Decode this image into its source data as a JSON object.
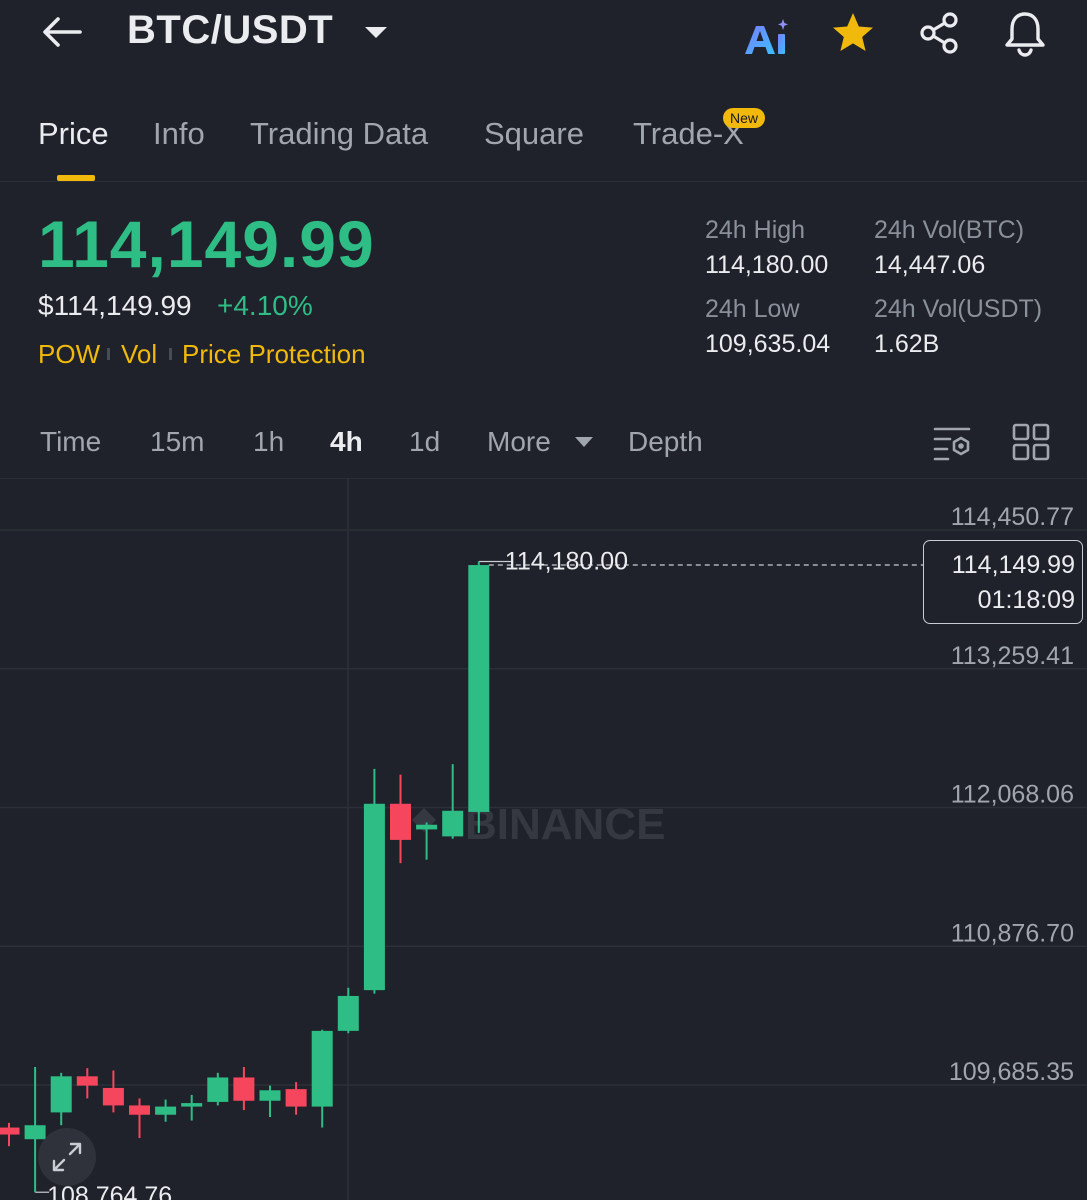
{
  "header": {
    "pair": "BTC/USDT",
    "icons": {
      "back": "arrow-left-icon",
      "caret": "caret-down-icon",
      "ai": "ai-icon",
      "favorite": "star-icon",
      "share": "share-icon",
      "alerts": "bell-icon"
    },
    "colors": {
      "favorite": "#f0b90b"
    }
  },
  "tabs": [
    {
      "label": "Price",
      "active": true
    },
    {
      "label": "Info"
    },
    {
      "label": "Trading Data"
    },
    {
      "label": "Square"
    },
    {
      "label": "Trade-X",
      "badge": "New"
    }
  ],
  "price": {
    "last": "114,149.99",
    "usd": "$114,149.99",
    "change": "+4.10%",
    "tags": [
      "POW",
      "Vol",
      "Price Protection"
    ]
  },
  "stats": {
    "high_label": "24h High",
    "high_value": "114,180.00",
    "vol_btc_label": "24h Vol(BTC)",
    "vol_btc_value": "14,447.06",
    "low_label": "24h Low",
    "low_value": "109,635.04",
    "vol_usdt_label": "24h Vol(USDT)",
    "vol_usdt_value": "1.62B"
  },
  "intervals": {
    "items": [
      "Time",
      "15m",
      "1h",
      "4h",
      "1d",
      "More",
      "Depth"
    ],
    "active": "4h"
  },
  "colors": {
    "up": "#2ebd85",
    "down": "#f6465d",
    "accent": "#f0b90b",
    "background": "#1f222a"
  },
  "chart_data": {
    "type": "candlestick",
    "interval": "4h",
    "y_axis_labels": [
      "114,450.77",
      "113,259.41",
      "112,068.06",
      "110,876.70",
      "109,685.35"
    ],
    "ylim": [
      108700,
      114500
    ],
    "high_marker": "114,180.00",
    "low_marker": "108,764.76",
    "current_price": "114,149.99",
    "countdown": "01:18:09",
    "watermark": "BINANCE",
    "candles": [
      {
        "o": 109320,
        "c": 109260,
        "h": 109360,
        "l": 109160
      },
      {
        "o": 109220,
        "c": 109340,
        "h": 109840,
        "l": 108765
      },
      {
        "o": 109450,
        "c": 109760,
        "h": 109790,
        "l": 109340
      },
      {
        "o": 109760,
        "c": 109680,
        "h": 109830,
        "l": 109570
      },
      {
        "o": 109660,
        "c": 109510,
        "h": 109810,
        "l": 109450
      },
      {
        "o": 109510,
        "c": 109430,
        "h": 109570,
        "l": 109230
      },
      {
        "o": 109430,
        "c": 109500,
        "h": 109560,
        "l": 109370
      },
      {
        "o": 109500,
        "c": 109530,
        "h": 109600,
        "l": 109380
      },
      {
        "o": 109540,
        "c": 109750,
        "h": 109790,
        "l": 109510
      },
      {
        "o": 109750,
        "c": 109550,
        "h": 109840,
        "l": 109470
      },
      {
        "o": 109550,
        "c": 109640,
        "h": 109680,
        "l": 109410
      },
      {
        "o": 109650,
        "c": 109500,
        "h": 109710,
        "l": 109430
      },
      {
        "o": 109500,
        "c": 110150,
        "h": 110160,
        "l": 109320
      },
      {
        "o": 110150,
        "c": 110450,
        "h": 110520,
        "l": 110130
      },
      {
        "o": 110500,
        "c": 112100,
        "h": 112400,
        "l": 110470
      },
      {
        "o": 112100,
        "c": 111790,
        "h": 112350,
        "l": 111590
      },
      {
        "o": 111880,
        "c": 111920,
        "h": 111940,
        "l": 111620
      },
      {
        "o": 111820,
        "c": 112040,
        "h": 112440,
        "l": 111800
      },
      {
        "o": 112030,
        "c": 114150,
        "h": 114180,
        "l": 111850
      }
    ]
  }
}
